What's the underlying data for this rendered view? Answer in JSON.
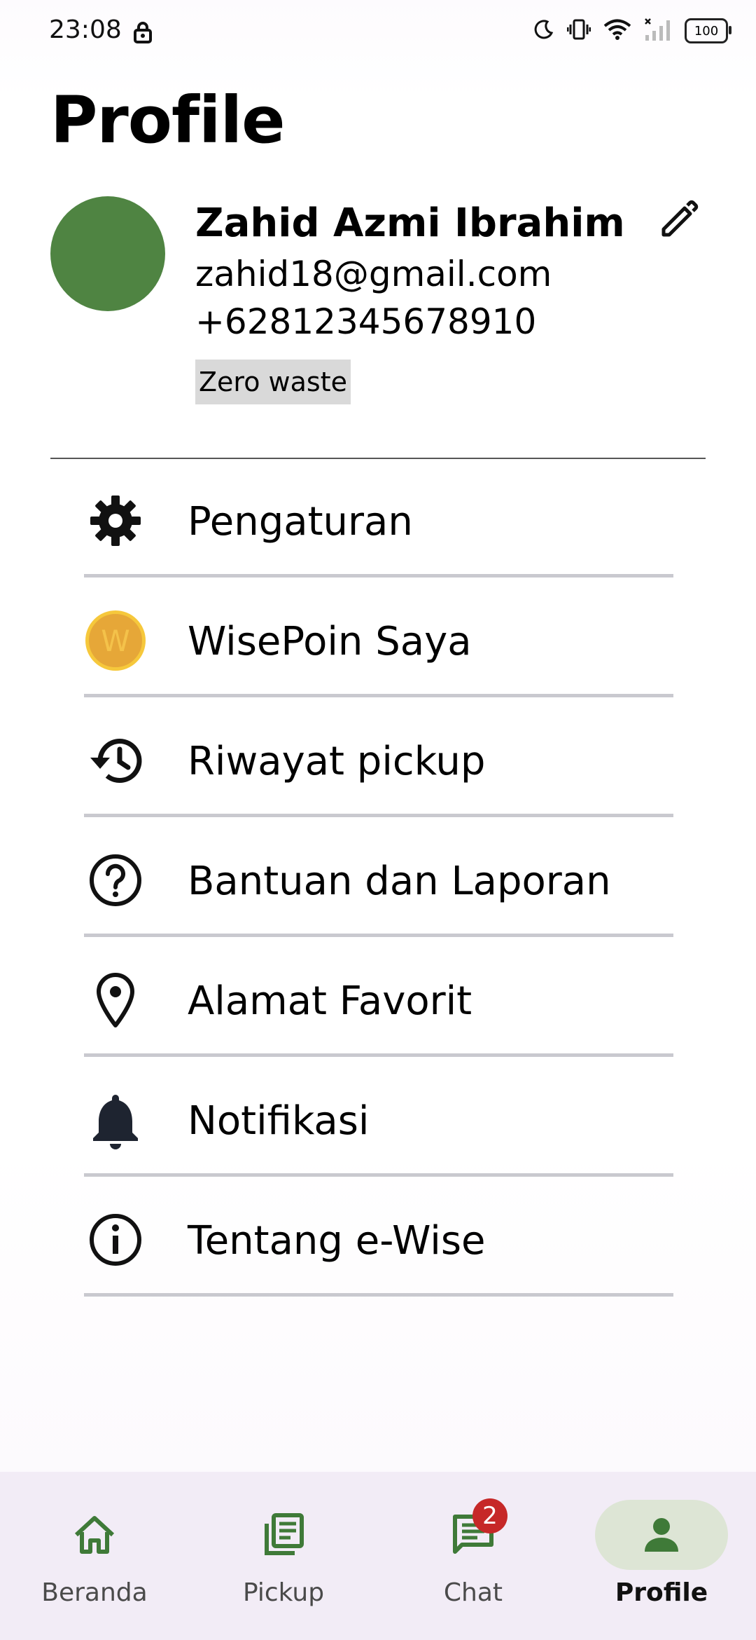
{
  "status_bar": {
    "time": "23:08",
    "battery": "100",
    "icons": [
      "lock-icon",
      "moon-icon",
      "vibrate-icon",
      "wifi-icon",
      "signal-icon"
    ]
  },
  "page_title": "Profile",
  "profile": {
    "name": "Zahid Azmi Ibrahim",
    "email": "zahid18@gmail.com",
    "phone": "+62812345678910",
    "tag": "Zero waste",
    "avatar_color": "#4f8442"
  },
  "menu": [
    {
      "label": "Pengaturan",
      "icon": "gear-icon"
    },
    {
      "label": "WisePoin Saya",
      "icon": "coin-icon",
      "coin_letter": "W"
    },
    {
      "label": "Riwayat pickup",
      "icon": "history-icon"
    },
    {
      "label": "Bantuan dan Laporan",
      "icon": "help-icon"
    },
    {
      "label": "Alamat Favorit",
      "icon": "location-pin-icon"
    },
    {
      "label": "Notifikasi",
      "icon": "bell-icon"
    },
    {
      "label": "Tentang e-Wise",
      "icon": "info-icon"
    }
  ],
  "bottom_nav": {
    "items": [
      {
        "label": "Beranda",
        "icon": "home-icon"
      },
      {
        "label": "Pickup",
        "icon": "pickup-icon"
      },
      {
        "label": "Chat",
        "icon": "chat-icon",
        "badge": "2"
      },
      {
        "label": "Profile",
        "icon": "person-icon",
        "active": true
      }
    ]
  },
  "colors": {
    "accent_green": "#3f7a38",
    "active_pill": "#dde5d5",
    "nav_background": "#f2ecf6",
    "badge_red": "#c62828"
  }
}
